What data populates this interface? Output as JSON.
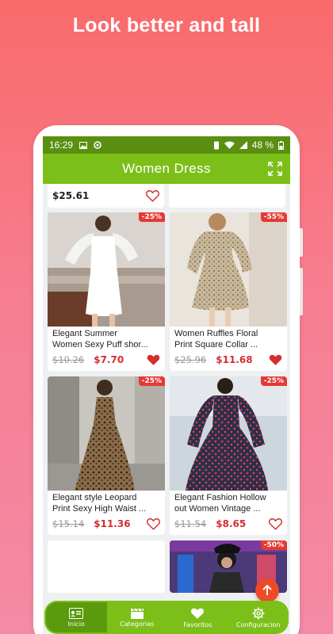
{
  "promo": {
    "title": "Look better and tall"
  },
  "status_bar": {
    "time": "16:29",
    "battery": "48 %"
  },
  "app_bar": {
    "title": "Women Dress"
  },
  "top_partial": {
    "price": "$25.61"
  },
  "products": [
    {
      "name_line1": "Elegant Summer",
      "name_line2": "Women Sexy Puff shor...",
      "old_price": "$10.26",
      "price": "$7.70",
      "discount": "-25%",
      "favorite": true
    },
    {
      "name_line1": "Women Ruffles Floral",
      "name_line2": "Print Square Collar ...",
      "old_price": "$25.96",
      "price": "$11.68",
      "discount": "-55%",
      "favorite": true
    },
    {
      "name_line1": "Elegant style Leopard",
      "name_line2": "Print Sexy High Waist ...",
      "old_price": "$15.14",
      "price": "$11.36",
      "discount": "-25%",
      "favorite": false
    },
    {
      "name_line1": "Elegant Fashion Hollow",
      "name_line2": "out Women Vintage ...",
      "old_price": "$11.54",
      "price": "$8.65",
      "discount": "-25%",
      "favorite": false
    },
    {
      "discount": "-50%"
    }
  ],
  "nav": [
    {
      "label": "Inicio",
      "icon": "id-card-icon",
      "active": true
    },
    {
      "label": "Categorias",
      "icon": "clapperboard-icon",
      "active": false
    },
    {
      "label": "Favoritos",
      "icon": "heart-icon",
      "active": false
    },
    {
      "label": "Configuracion",
      "icon": "gear-icon",
      "active": false
    }
  ],
  "colors": {
    "app_bar": "#7cbf19",
    "status_bar": "#5a8f12",
    "price": "#d32f2f",
    "badge": "#e53935",
    "fab": "#ef4a27"
  }
}
